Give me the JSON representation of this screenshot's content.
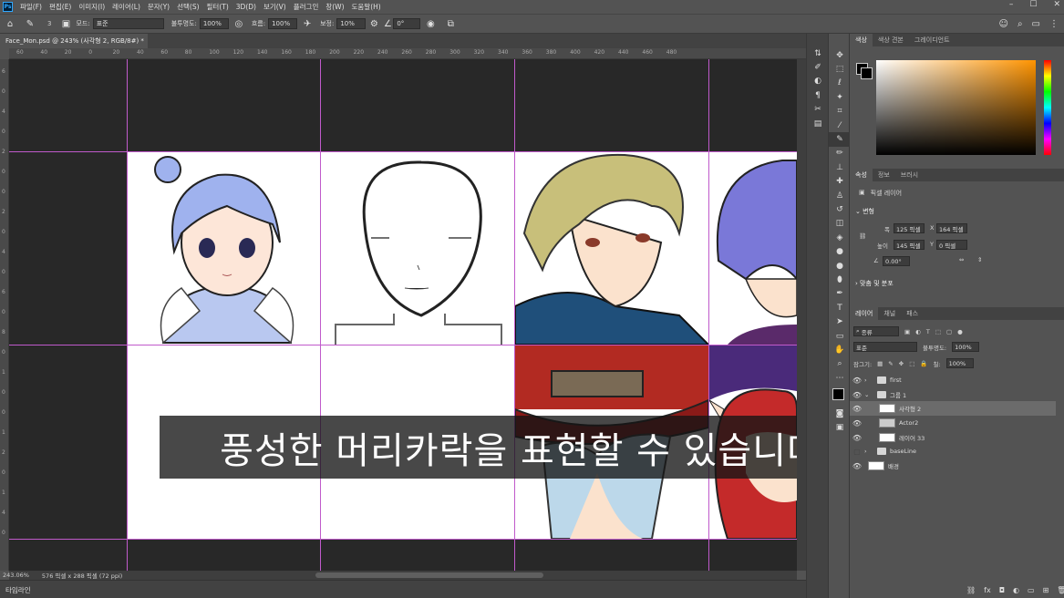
{
  "menubar": {
    "logo": "Ps",
    "items": [
      "파일(F)",
      "편집(E)",
      "이미지(I)",
      "레이어(L)",
      "문자(Y)",
      "선택(S)",
      "필터(T)",
      "3D(D)",
      "보기(V)",
      "플러그인",
      "창(W)",
      "도움말(H)"
    ]
  },
  "options": {
    "brush_size": "3",
    "mode_label": "모드:",
    "mode_value": "표준",
    "opacity_label": "불투명도:",
    "opacity_value": "100%",
    "flow_label": "흐름:",
    "flow_value": "100%",
    "smoothing_label": "보정:",
    "smoothing_value": "10%",
    "angle_value": "0°"
  },
  "document": {
    "tab_title": "Face_Mon.psd @ 243% (사각형 2, RGB/8#) *"
  },
  "ruler": {
    "top_ticks": [
      "60",
      "40",
      "20",
      "0",
      "20",
      "40",
      "60",
      "80",
      "100",
      "120",
      "140",
      "160",
      "180",
      "200",
      "220",
      "240",
      "260",
      "280",
      "300",
      "320",
      "340",
      "360",
      "380",
      "400",
      "420",
      "440",
      "460",
      "480"
    ],
    "left_ticks": [
      "6",
      "0",
      "4",
      "0",
      "2",
      "0",
      "0",
      "2",
      "0",
      "4",
      "0",
      "6",
      "0",
      "8",
      "0",
      "1",
      "0",
      "0",
      "1",
      "2",
      "0",
      "1",
      "4",
      "0"
    ]
  },
  "status": {
    "zoom": "243.06%",
    "doc_size": "576 픽셀 x 288 픽셀 (72 ppi)"
  },
  "subtitle": "풍성한 머리카락을 표현할 수 있습니다",
  "timeline": "타임라인",
  "color_panel": {
    "tabs": [
      "색상",
      "색상 견본",
      "그레이디언트"
    ],
    "accent": "#ff9400"
  },
  "properties_panel": {
    "tabs": [
      "속성",
      "정보",
      "브러시"
    ],
    "kind": "픽셀 레이어",
    "transform_label": "변형",
    "w_label": "폭",
    "w_value": "125 픽셀",
    "x_label": "X",
    "x_value": "164 픽셀",
    "h_label": "높이",
    "h_value": "145 픽셀",
    "y_label": "Y",
    "y_value": "0 픽셀",
    "angle_value": "0.00°",
    "align_label": "맞춤 및 분포"
  },
  "layers_panel": {
    "tabs": [
      "레이어",
      "채널",
      "패스"
    ],
    "filter_value": "종류",
    "blend_value": "표준",
    "opacity_label": "불투명도:",
    "opacity_value": "100%",
    "lock_label": "잠그기:",
    "fill_label": "칠:",
    "fill_value": "100%",
    "layers": [
      {
        "name": "first",
        "type": "folder"
      },
      {
        "name": "그룹 1",
        "type": "folder"
      },
      {
        "name": "사각형 2",
        "type": "layer"
      },
      {
        "name": "Actor2",
        "type": "layer"
      },
      {
        "name": "레이어 33",
        "type": "layer"
      },
      {
        "name": "baseLine",
        "type": "folder"
      },
      {
        "name": "배경",
        "type": "layer"
      }
    ]
  }
}
